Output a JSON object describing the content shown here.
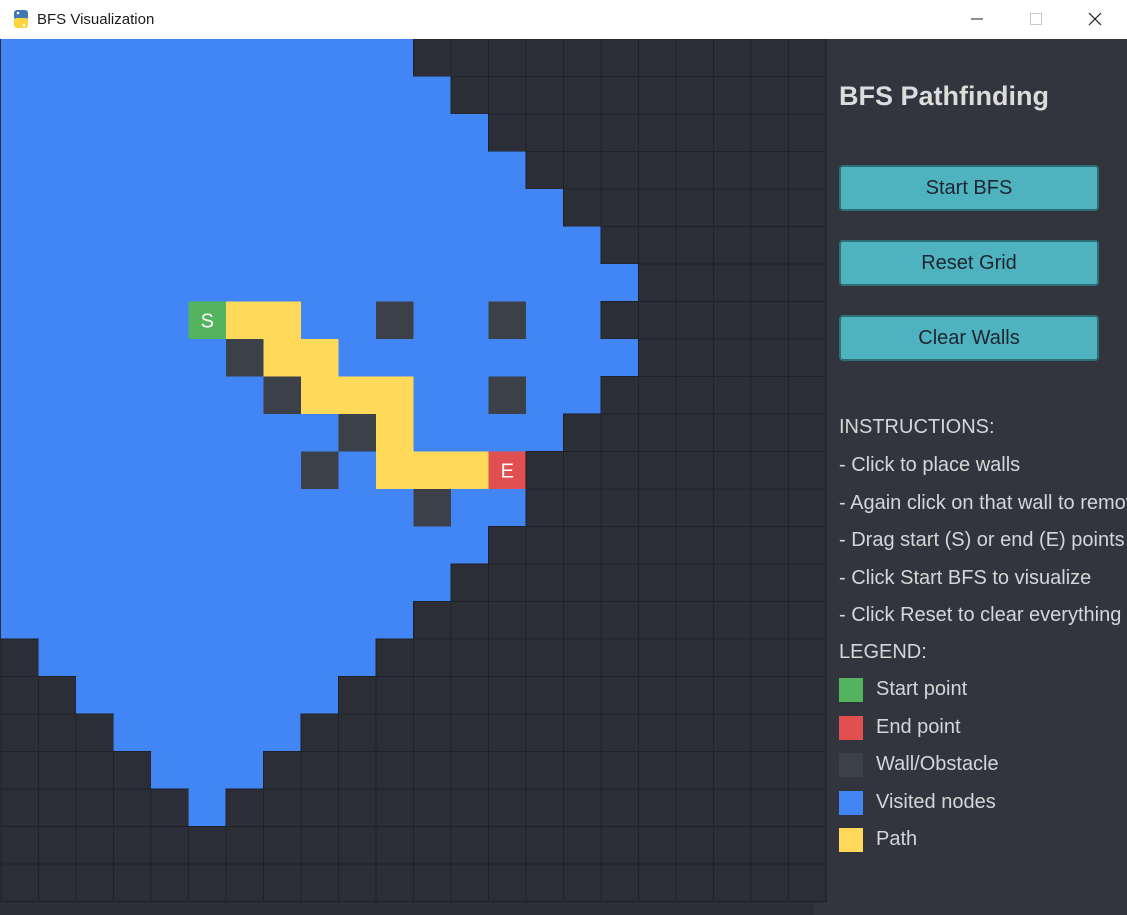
{
  "window": {
    "title": "BFS Visualization",
    "icon": "python-logo-icon",
    "controls": [
      "minimize-icon",
      "maximize-icon",
      "close-icon"
    ]
  },
  "colors": {
    "background": "#2b2e36",
    "panel": "#32353d",
    "visited": "#4285f4",
    "path": "#ffd95a",
    "start": "#54b45e",
    "end": "#e05050",
    "wall": "#3c4049",
    "button": "#4fb3bf"
  },
  "grid": {
    "cols": 22,
    "rows": 23,
    "start": {
      "row": 7,
      "col": 5,
      "label": "S"
    },
    "end": {
      "row": 11,
      "col": 13,
      "label": "E"
    },
    "visited_runs": [
      [
        0,
        0,
        10
      ],
      [
        1,
        0,
        11
      ],
      [
        2,
        0,
        12
      ],
      [
        3,
        0,
        13
      ],
      [
        4,
        0,
        14
      ],
      [
        5,
        0,
        15
      ],
      [
        6,
        0,
        16
      ],
      [
        7,
        0,
        15
      ],
      [
        8,
        0,
        16
      ],
      [
        9,
        0,
        15
      ],
      [
        10,
        0,
        14
      ],
      [
        11,
        0,
        13
      ],
      [
        12,
        0,
        13
      ],
      [
        13,
        0,
        12
      ],
      [
        14,
        0,
        11
      ],
      [
        15,
        0,
        10
      ],
      [
        16,
        1,
        9
      ],
      [
        17,
        2,
        8
      ],
      [
        18,
        3,
        7
      ],
      [
        19,
        4,
        6
      ],
      [
        20,
        5,
        5
      ]
    ],
    "walls": [
      [
        7,
        10
      ],
      [
        7,
        13
      ],
      [
        8,
        6
      ],
      [
        9,
        7
      ],
      [
        9,
        13
      ],
      [
        10,
        9
      ],
      [
        11,
        8
      ],
      [
        12,
        11
      ]
    ],
    "path": [
      [
        7,
        6
      ],
      [
        7,
        7
      ],
      [
        8,
        7
      ],
      [
        8,
        8
      ],
      [
        9,
        8
      ],
      [
        9,
        9
      ],
      [
        9,
        10
      ],
      [
        10,
        10
      ],
      [
        11,
        10
      ],
      [
        11,
        11
      ],
      [
        11,
        12
      ]
    ]
  },
  "panel": {
    "title": "BFS Pathfinding",
    "buttons": {
      "start": "Start BFS",
      "reset": "Reset Grid",
      "clear": "Clear Walls"
    },
    "instructions_heading": "INSTRUCTIONS:",
    "instructions": [
      "- Click to place walls",
      "- Again click on that wall to remove",
      "- Drag start (S) or end (E) points",
      "- Click Start BFS to visualize",
      "- Click Reset to clear everything"
    ],
    "legend_heading": "LEGEND:",
    "legend": [
      {
        "label": "Start point",
        "color": "#54b45e"
      },
      {
        "label": "End point",
        "color": "#e05050"
      },
      {
        "label": "Wall/Obstacle",
        "color": "#3c4049"
      },
      {
        "label": "Visited nodes",
        "color": "#4285f4"
      },
      {
        "label": "Path",
        "color": "#ffd95a"
      }
    ]
  }
}
